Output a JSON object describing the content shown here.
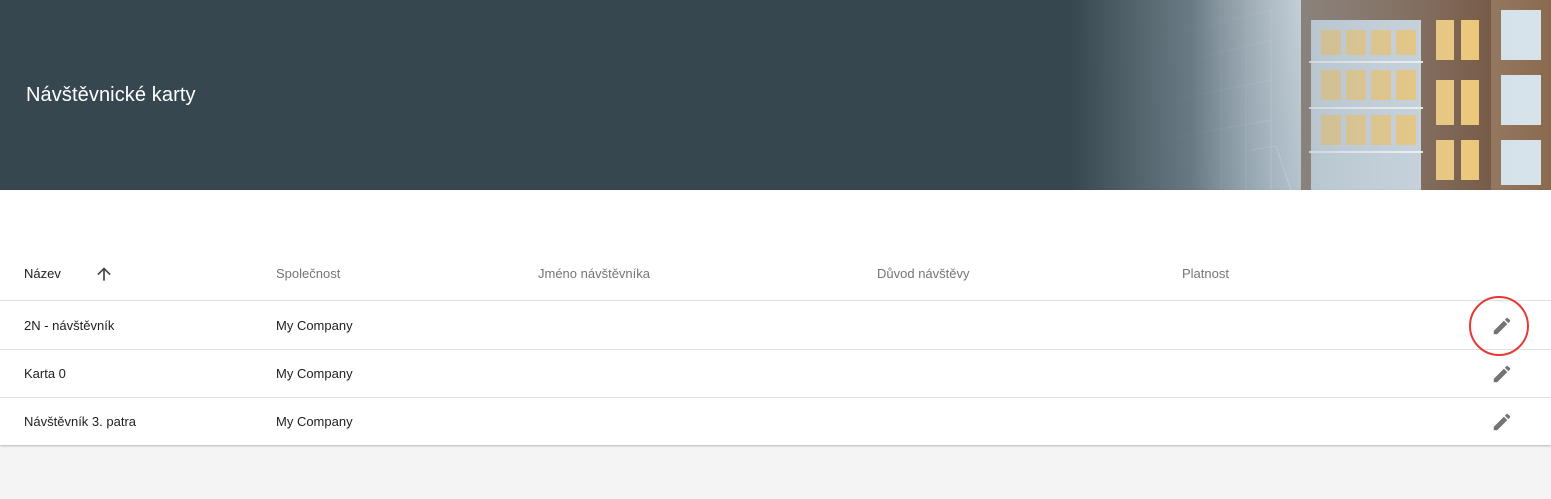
{
  "header": {
    "title": "Návštěvnické karty"
  },
  "table": {
    "columns": [
      {
        "label": "Název",
        "sorted": "ascending"
      },
      {
        "label": "Společnost"
      },
      {
        "label": "Jméno návštěvníka"
      },
      {
        "label": "Důvod návštěvy"
      },
      {
        "label": "Platnost"
      }
    ],
    "rows": [
      {
        "name": "2N - návštěvník",
        "company": "My Company",
        "visitor_name": "",
        "visit_reason": "",
        "validity": "",
        "action_icon": "pencil-icon",
        "highlighted": true
      },
      {
        "name": "Karta 0",
        "company": "My Company",
        "visitor_name": "",
        "visit_reason": "",
        "validity": "",
        "action_icon": "pencil-icon"
      },
      {
        "name": "Návštěvník 3. patra",
        "company": "My Company",
        "visitor_name": "",
        "visit_reason": "",
        "validity": "",
        "action_icon": "pencil-icon"
      }
    ]
  },
  "colors": {
    "header_bg": "#37474f",
    "highlight": "#e53935",
    "icon": "#757575"
  }
}
